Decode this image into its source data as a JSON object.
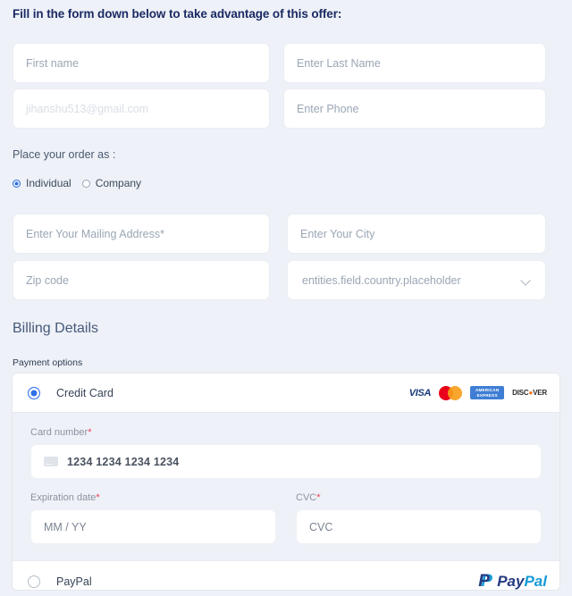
{
  "form": {
    "title": "Fill in the form down below to take advantage of this offer:",
    "fields": {
      "first_name_placeholder": "First name",
      "last_name_placeholder": "Enter Last Name",
      "email_placeholder": "jihanshu513@gmail.com",
      "phone_placeholder": "Enter Phone",
      "address_placeholder": "Enter Your Mailing Address*",
      "city_placeholder": "Enter Your City",
      "zip_placeholder": "Zip code",
      "country_placeholder": "entities.field.country.placeholder"
    },
    "order_as": {
      "label": "Place your order as :",
      "options": [
        {
          "label": "Individual",
          "selected": true
        },
        {
          "label": "Company",
          "selected": false
        }
      ]
    }
  },
  "billing": {
    "title": "Billing Details",
    "payment_options_label": "Payment options",
    "credit_card": {
      "label": "Credit Card",
      "selected": true,
      "brands": [
        "VISA",
        "Mastercard",
        "AMERICAN EXPRESS",
        "DISCOVER"
      ],
      "amex_line1": "AMERICAN",
      "amex_line2": "EXPRESS",
      "discover_part1": "DISC",
      "discover_dot": "●",
      "discover_part2": "VER",
      "visa_text": "VISA",
      "card_number": {
        "label": "Card number",
        "required_mark": "*",
        "placeholder": "1234 1234 1234 1234"
      },
      "expiration": {
        "label": "Expiration date",
        "required_mark": "*",
        "placeholder": "MM / YY"
      },
      "cvc": {
        "label": "CVC",
        "required_mark": "*",
        "placeholder": "CVC"
      }
    },
    "paypal": {
      "label": "PayPal",
      "selected": false,
      "logo_pay": "Pay",
      "logo_pal": "Pal",
      "logo_mark": "P"
    }
  },
  "colors": {
    "page_bg": "#eef1f7",
    "accent": "#2f72e8",
    "title": "#1b2a63",
    "heading": "#46597c",
    "required": "#e8435a",
    "visa": "#1a3a7a",
    "mastercard_red": "#eb001b",
    "mastercard_orange": "#f79e1b",
    "amex_blue": "#3f7ed4",
    "discover_orange": "#f47216",
    "paypal_dark": "#253b80",
    "paypal_light": "#179bd7"
  }
}
